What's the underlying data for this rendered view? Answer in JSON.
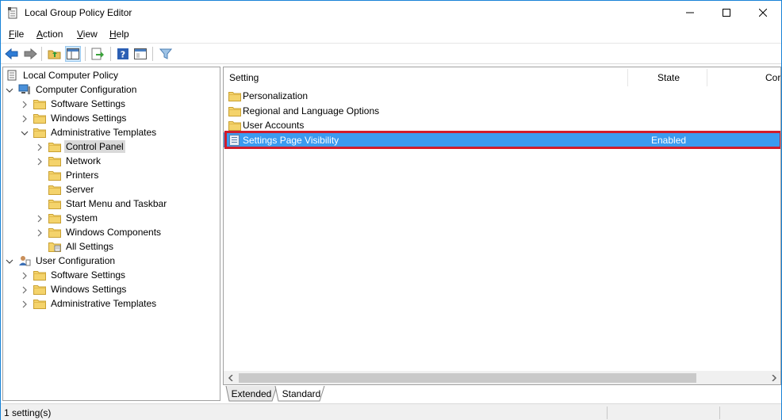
{
  "window": {
    "title": "Local Group Policy Editor"
  },
  "menu": [
    {
      "label": "File",
      "key": "F",
      "rest": "ile"
    },
    {
      "label": "Action",
      "key": "A",
      "rest": "ction"
    },
    {
      "label": "View",
      "key": "V",
      "rest": "iew"
    },
    {
      "label": "Help",
      "key": "H",
      "rest": "elp"
    }
  ],
  "tree": {
    "root": "Local Computer Policy",
    "computer_config": "Computer Configuration",
    "cc_software": "Software Settings",
    "cc_windows": "Windows Settings",
    "cc_admin": "Administrative Templates",
    "control_panel": "Control Panel",
    "network": "Network",
    "printers": "Printers",
    "server": "Server",
    "start_menu": "Start Menu and Taskbar",
    "system": "System",
    "windows_components": "Windows Components",
    "all_settings": "All Settings",
    "user_config": "User Configuration",
    "uc_software": "Software Settings",
    "uc_windows": "Windows Settings",
    "uc_admin": "Administrative Templates"
  },
  "list": {
    "columns": {
      "setting": "Setting",
      "state": "State",
      "comment": "Cor"
    },
    "rows": [
      {
        "name": "Personalization",
        "state": ""
      },
      {
        "name": "Regional and Language Options",
        "state": ""
      },
      {
        "name": "User Accounts",
        "state": ""
      },
      {
        "name": "Settings Page Visibility",
        "state": "Enabled"
      }
    ]
  },
  "tabs": {
    "extended": "Extended",
    "standard": "Standard"
  },
  "status": {
    "text": "1 setting(s)"
  },
  "colors": {
    "selection": "#3b9bf0",
    "highlight_box": "#d11c2b",
    "folder": "#f4d36b"
  }
}
